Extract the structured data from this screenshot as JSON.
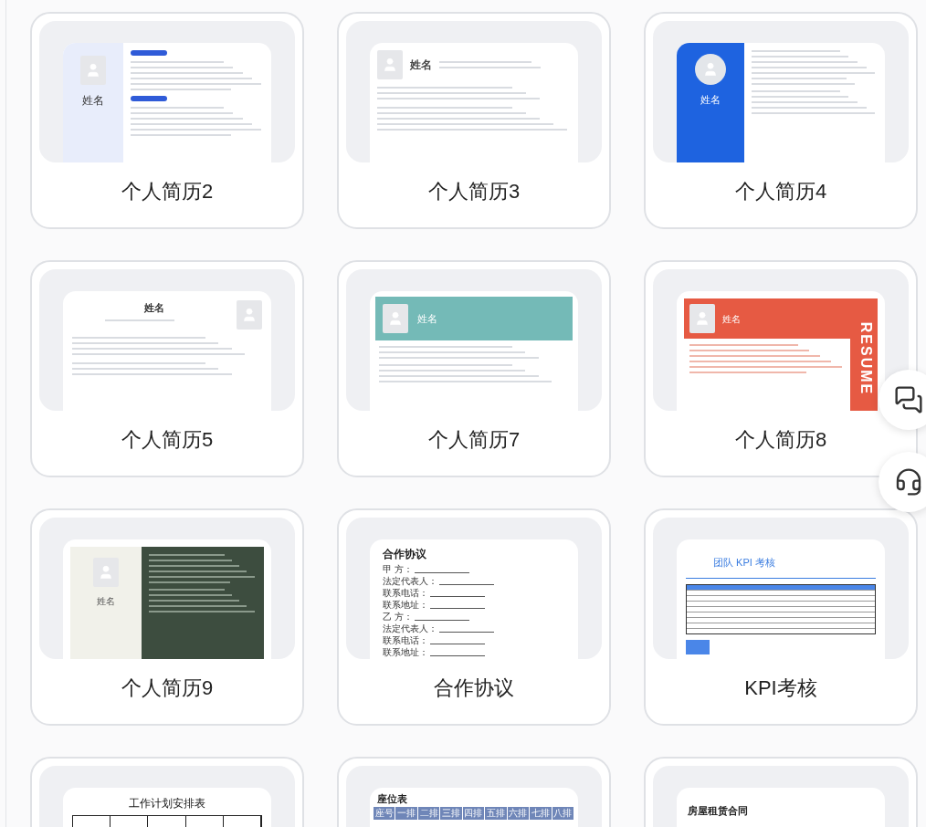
{
  "cards": [
    {
      "title": "个人简历2",
      "preview": {
        "kind": "resume-sidebar",
        "heading": "姓名"
      }
    },
    {
      "title": "个人简历3",
      "preview": {
        "kind": "resume-top",
        "heading": "姓名"
      }
    },
    {
      "title": "个人简历4",
      "preview": {
        "kind": "resume-blue",
        "heading": "姓名"
      }
    },
    {
      "title": "个人简历5",
      "preview": {
        "kind": "resume-center",
        "heading": "姓名"
      }
    },
    {
      "title": "个人简历7",
      "preview": {
        "kind": "resume-teal",
        "heading": "姓名"
      }
    },
    {
      "title": "个人简历8",
      "preview": {
        "kind": "resume-red",
        "heading": "姓名",
        "side_text": "RESUME"
      }
    },
    {
      "title": "个人简历9",
      "preview": {
        "kind": "resume-green",
        "heading": "姓名"
      }
    },
    {
      "title": "合作协议",
      "preview": {
        "kind": "agreement",
        "heading": "合作协议",
        "lines": [
          "甲 方：",
          "法定代表人：",
          "联系电话：",
          "联系地址：",
          "乙 方：",
          "法定代表人：",
          "联系电话：",
          "联系地址："
        ]
      }
    },
    {
      "title": "KPI考核",
      "preview": {
        "kind": "kpi",
        "heading": "团队 KPI 考核"
      }
    },
    {
      "preview": {
        "kind": "plan",
        "heading": "工作计划安排表"
      }
    },
    {
      "preview": {
        "kind": "seat",
        "heading": "座位表",
        "columns": [
          "座号",
          "一排",
          "二排",
          "三排",
          "四排",
          "五排",
          "六排",
          "七排",
          "八排"
        ]
      }
    },
    {
      "preview": {
        "kind": "contract",
        "heading": "房屋租赁合同"
      }
    }
  ],
  "floating_buttons": [
    {
      "kind": "chat"
    },
    {
      "kind": "support"
    }
  ]
}
